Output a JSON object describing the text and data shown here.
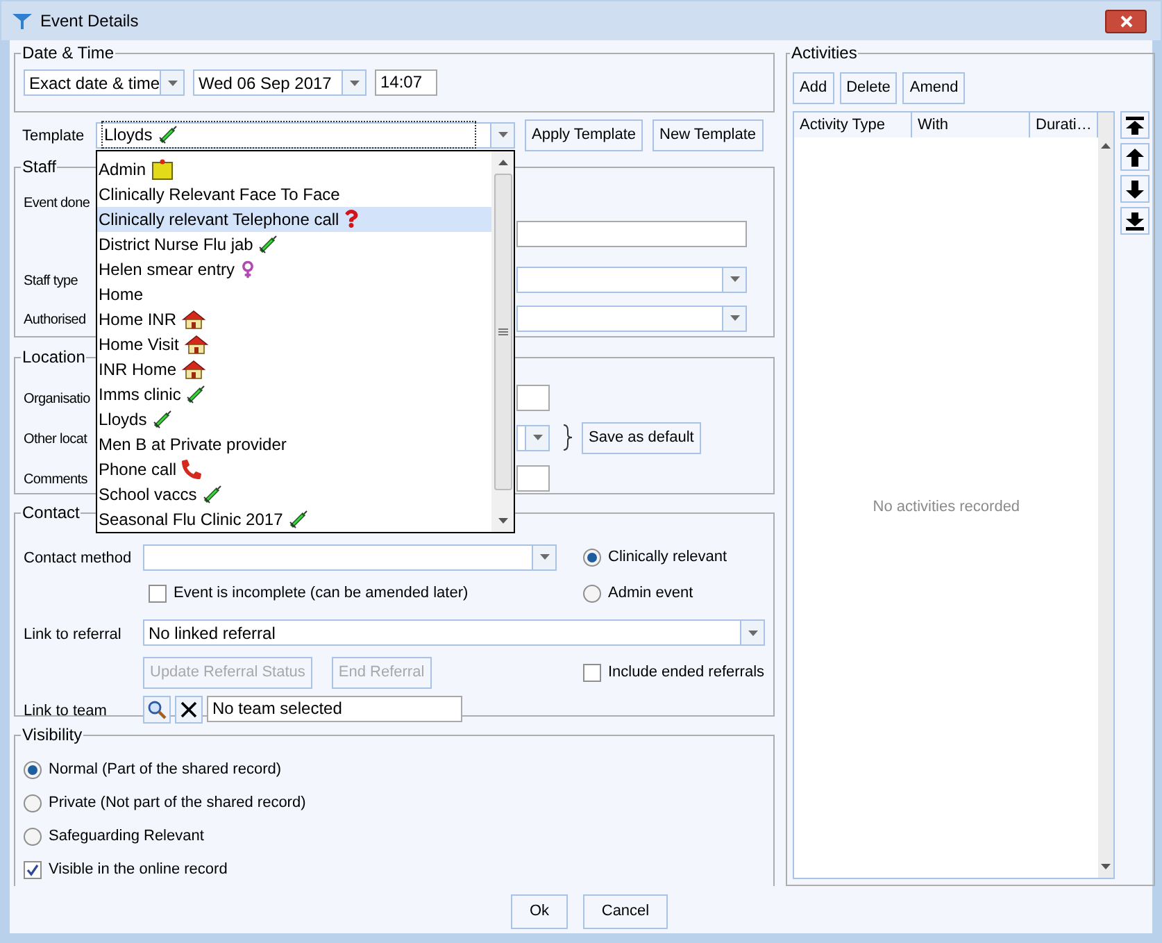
{
  "window": {
    "title": "Event Details"
  },
  "date_time": {
    "legend": "Date & Time",
    "mode": "Exact date & time",
    "date": "Wed 06 Sep 2017",
    "time": "14:07"
  },
  "template": {
    "label": "Template",
    "value": {
      "text": "Lloyds",
      "kind": "syringe"
    },
    "expanded": true,
    "buttons": [
      "Apply Template",
      "New Template"
    ],
    "options": [
      {
        "label": "Admin",
        "kind": "clipboard",
        "selected": false
      },
      {
        "label": "Clinically Relevant Face To Face",
        "kind": "plain",
        "selected": false
      },
      {
        "label": "Clinically relevant Telephone call",
        "kind": "question",
        "selected": true
      },
      {
        "label": "District Nurse Flu jab",
        "kind": "syringe",
        "selected": false
      },
      {
        "label": "Helen smear entry",
        "kind": "female",
        "selected": false
      },
      {
        "label": "Home",
        "kind": "plain",
        "selected": false
      },
      {
        "label": "Home INR",
        "kind": "house",
        "selected": false
      },
      {
        "label": "Home Visit",
        "kind": "house",
        "selected": false
      },
      {
        "label": "INR Home",
        "kind": "house",
        "selected": false
      },
      {
        "label": "Imms clinic",
        "kind": "syringe",
        "selected": false
      },
      {
        "label": "Lloyds",
        "kind": "syringe",
        "selected": false
      },
      {
        "label": "Men B at Private provider",
        "kind": "plain",
        "selected": false
      },
      {
        "label": "Phone call",
        "kind": "phone",
        "selected": false
      },
      {
        "label": "School vaccs",
        "kind": "syringe",
        "selected": false
      },
      {
        "label": "Seasonal Flu Clinic 2017",
        "kind": "syringe",
        "selected": false
      }
    ]
  },
  "staff": {
    "legend": "Staff",
    "event_done": "Event done",
    "staff_type": "Staff type",
    "authorised": "Authorised"
  },
  "location": {
    "legend": "Location",
    "organisation": "Organisatio",
    "other": "Other locat",
    "comments": "Comments",
    "save_default": "Save as default"
  },
  "contact": {
    "legend": "Contact",
    "method_label": "Contact method",
    "incomplete": {
      "label": "Event is incomplete (can be amended later)",
      "checked": false
    },
    "relevance": [
      {
        "label": "Clinically relevant",
        "selected": true
      },
      {
        "label": "Admin event",
        "selected": false
      }
    ],
    "referral_label": "Link to referral",
    "referral": "No linked referral",
    "referral_buttons": [
      {
        "label": "Update Referral Status",
        "disabled": true
      },
      {
        "label": "End Referral",
        "disabled": true
      }
    ],
    "include_ended": {
      "label": "Include ended referrals",
      "checked": false
    },
    "team_label": "Link to team",
    "team": "No team selected"
  },
  "visibility": {
    "legend": "Visibility",
    "options": [
      {
        "label": "Normal (Part of the shared record)",
        "selected": true
      },
      {
        "label": "Private (Not part of the shared record)",
        "selected": false
      },
      {
        "label": "Safeguarding Relevant",
        "selected": false
      }
    ],
    "online": {
      "label": "Visible in the online record",
      "checked": true
    }
  },
  "activities": {
    "legend": "Activities",
    "buttons": [
      "Add",
      "Delete",
      "Amend"
    ],
    "columns": [
      "Activity Type",
      "With",
      "Durati…"
    ],
    "empty": "No activities recorded"
  },
  "buttons": [
    "Ok",
    "Cancel"
  ]
}
